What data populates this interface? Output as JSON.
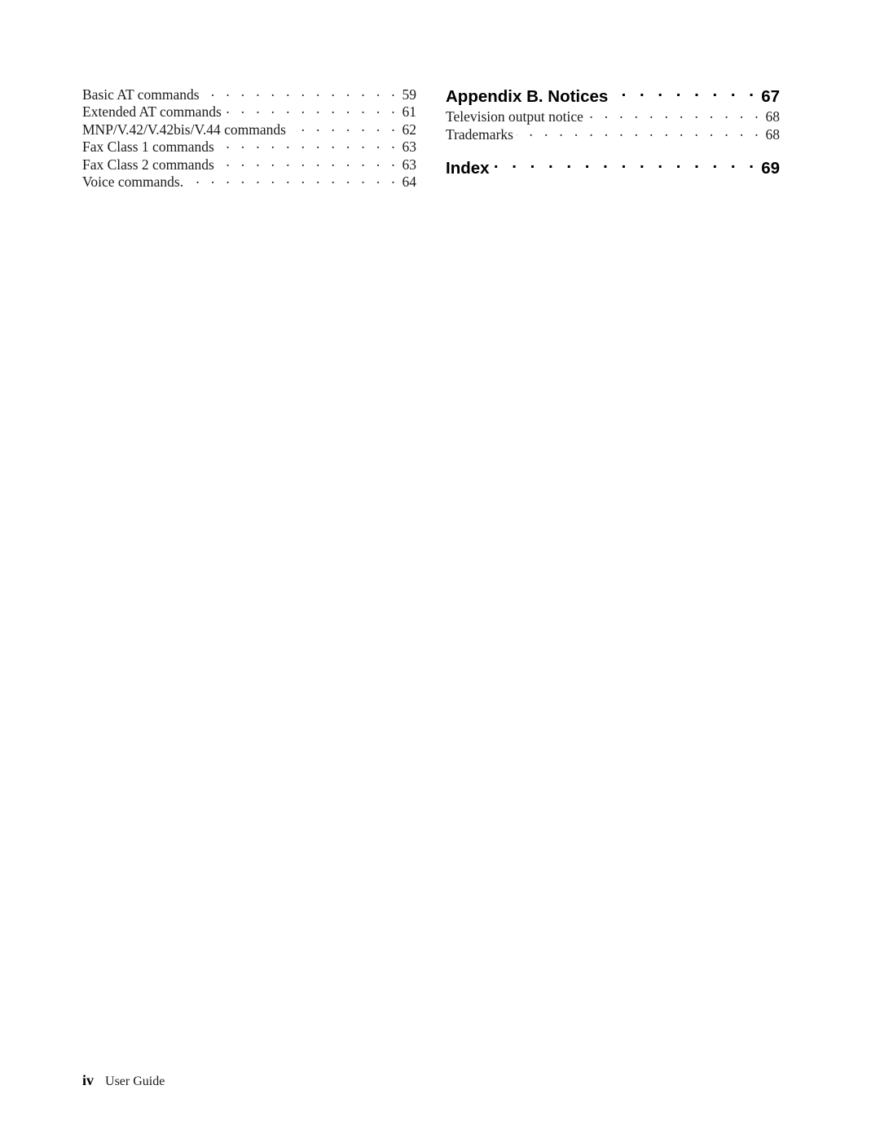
{
  "page": {
    "folio": "iv",
    "footer_title": "User Guide",
    "background_color": "#ffffff",
    "text_color": "#1a1a1a"
  },
  "toc": {
    "left_column": {
      "entries": [
        {
          "level": 2,
          "title": "Basic AT commands",
          "page": "59"
        },
        {
          "level": 2,
          "title": "Extended AT commands",
          "page": "61"
        },
        {
          "level": 2,
          "title": "MNP/V.42/V.42bis/V.44 commands",
          "page": "62"
        },
        {
          "level": 2,
          "title": "Fax Class 1 commands",
          "page": "63"
        },
        {
          "level": 2,
          "title": "Fax Class 2 commands",
          "page": "63"
        },
        {
          "level": 2,
          "title": "Voice commands.",
          "page": "64"
        }
      ]
    },
    "right_column": {
      "entries": [
        {
          "level": 1,
          "title": "Appendix B. Notices",
          "page": "67"
        },
        {
          "level": 2,
          "title": "Television output notice",
          "page": "68"
        },
        {
          "level": 2,
          "title": "Trademarks",
          "page": "68"
        },
        {
          "level": 1,
          "title": "Index",
          "page": "69",
          "gap_before": true
        }
      ]
    }
  }
}
